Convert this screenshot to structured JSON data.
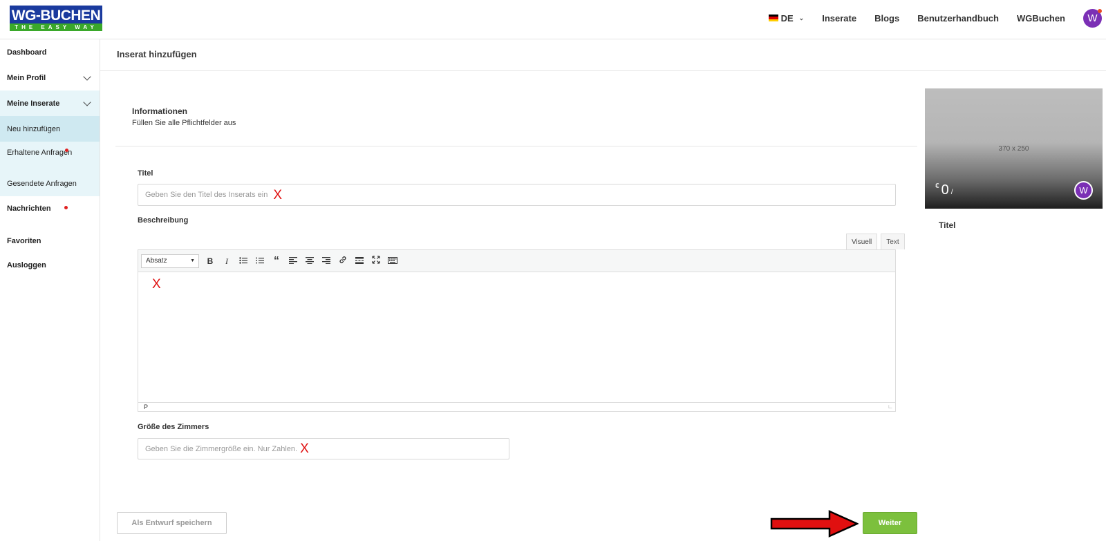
{
  "logo": {
    "line1": "WG-BUCHEN",
    "line2": "THE EASY WAY"
  },
  "topnav": {
    "language": "DE",
    "links": [
      "Inserate",
      "Blogs",
      "Benutzerhandbuch",
      "WGBuchen"
    ],
    "avatar_initial": "W"
  },
  "sidebar": {
    "items": [
      {
        "label": "Dashboard"
      },
      {
        "label": "Mein Profil"
      },
      {
        "label": "Meine Inserate"
      },
      {
        "label": "Neu hinzufügen"
      },
      {
        "label": "Erhaltene Anfragen"
      },
      {
        "label": "Gesendete Anfragen"
      },
      {
        "label": "Nachrichten"
      },
      {
        "label": "Favoriten"
      },
      {
        "label": "Ausloggen"
      }
    ]
  },
  "page": {
    "title": "Inserat hinzufügen",
    "section_title": "Informationen",
    "section_subtitle": "Füllen Sie alle Pflichtfelder aus"
  },
  "form": {
    "title_label": "Titel",
    "title_placeholder": "Geben Sie den Titel des Inserats ein",
    "description_label": "Beschreibung",
    "editor_tab_visual": "Visuell",
    "editor_tab_text": "Text",
    "format_select": "Absatz",
    "editor_status": "P",
    "room_size_label": "Größe des Zimmers",
    "room_size_placeholder": "Geben Sie die Zimmergröße ein. Nur Zahlen.",
    "error_mark": "X"
  },
  "preview": {
    "image_size": "370 x 250",
    "currency": "€",
    "price": "0",
    "price_suffix": "/",
    "avatar_initial": "W",
    "title": "Titel"
  },
  "actions": {
    "draft_label": "Als Entwurf speichern",
    "next_label": "Weiter"
  },
  "colors": {
    "accent_green": "#7cc03d",
    "avatar_purple": "#7b2fb5",
    "error_red": "#e01010",
    "sidebar_highlight": "#e7f5f9"
  }
}
